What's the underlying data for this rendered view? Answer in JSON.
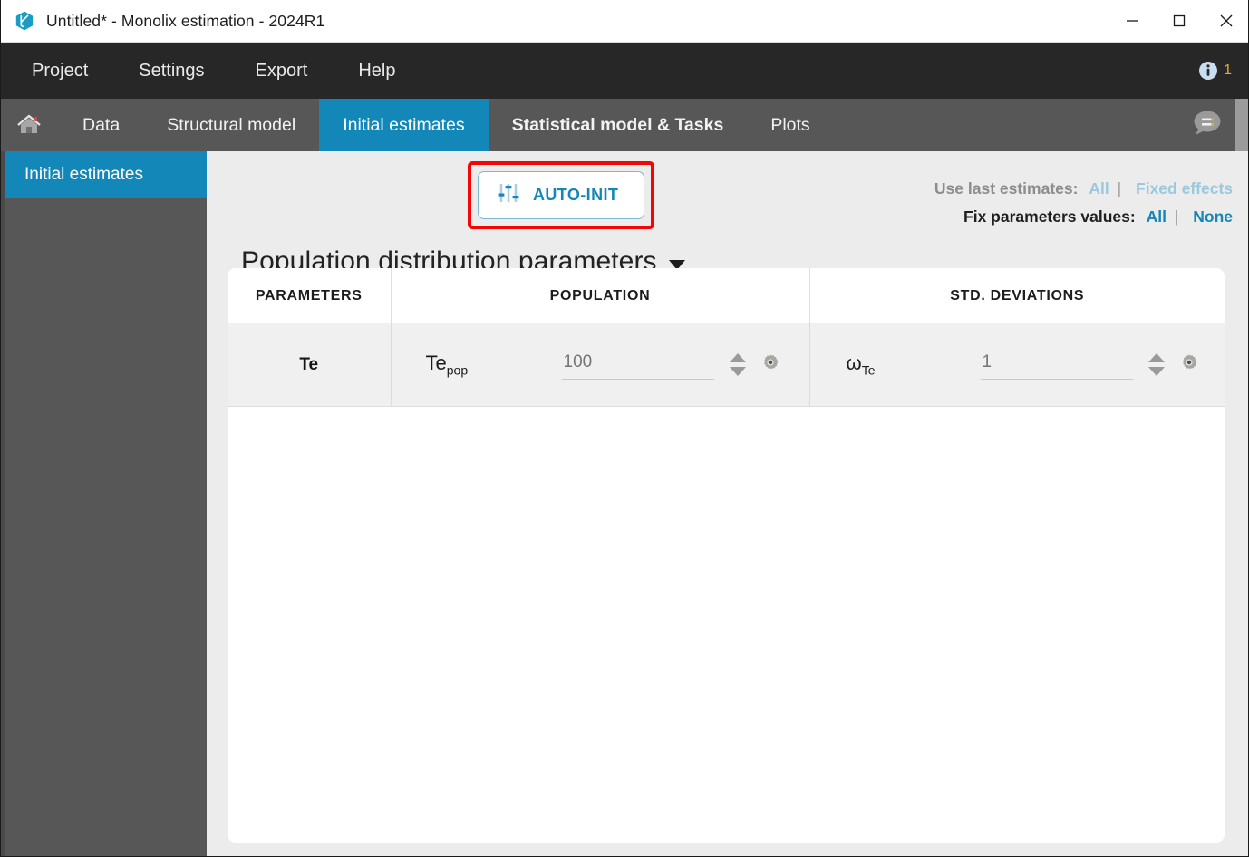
{
  "window": {
    "title": "Untitled* - Monolix estimation - 2024R1",
    "app_icon": "monolix-logo-icon",
    "controls": {
      "minimize": "minimize-icon",
      "maximize": "maximize-icon",
      "close": "close-icon"
    }
  },
  "menubar": {
    "items": [
      {
        "label": "Project"
      },
      {
        "label": "Settings"
      },
      {
        "label": "Export"
      },
      {
        "label": "Help"
      }
    ],
    "info": {
      "icon": "info-icon",
      "count": "1"
    }
  },
  "tabbar": {
    "home_icon": "home-icon",
    "tabs": [
      {
        "label": "Data",
        "active": false,
        "bold": false
      },
      {
        "label": "Structural model",
        "active": false,
        "bold": false
      },
      {
        "label": "Initial estimates",
        "active": true,
        "bold": false
      },
      {
        "label": "Statistical model & Tasks",
        "active": false,
        "bold": true
      },
      {
        "label": "Plots",
        "active": false,
        "bold": false
      }
    ],
    "chat_icon": "chat-bubble-icon"
  },
  "sidebar": {
    "items": [
      {
        "label": "Initial estimates",
        "active": true
      }
    ]
  },
  "toolbar": {
    "auto_init_label": "AUTO-INIT",
    "auto_init_icon": "sliders-icon",
    "highlight_color": "#f40606",
    "accent_color": "#1387b8"
  },
  "estimates": {
    "use_last": {
      "label": "Use last estimates:",
      "options": [
        "All",
        "Fixed effects"
      ],
      "separator": "|",
      "disabled": true
    },
    "fix_params": {
      "label": "Fix parameters values:",
      "options": [
        "All",
        "None"
      ],
      "separator": "|",
      "disabled": false
    }
  },
  "section": {
    "title": "Population distribution parameters",
    "caret": "chevron-down-icon",
    "expanded": true
  },
  "table": {
    "headers": [
      "PARAMETERS",
      "POPULATION",
      "STD. DEVIATIONS"
    ],
    "rows": [
      {
        "parameter": "Te",
        "population": {
          "symbol_base": "Te",
          "symbol_sub": "pop",
          "value": "",
          "placeholder": "100",
          "spin_up_icon": "caret-up-icon",
          "spin_down_icon": "caret-down-icon",
          "settings_icon": "gear-icon"
        },
        "std_deviation": {
          "symbol_base": "ω",
          "symbol_sub": "Te",
          "value": "",
          "placeholder": "1",
          "spin_up_icon": "caret-up-icon",
          "spin_down_icon": "caret-down-icon",
          "settings_icon": "gear-icon"
        }
      }
    ]
  }
}
